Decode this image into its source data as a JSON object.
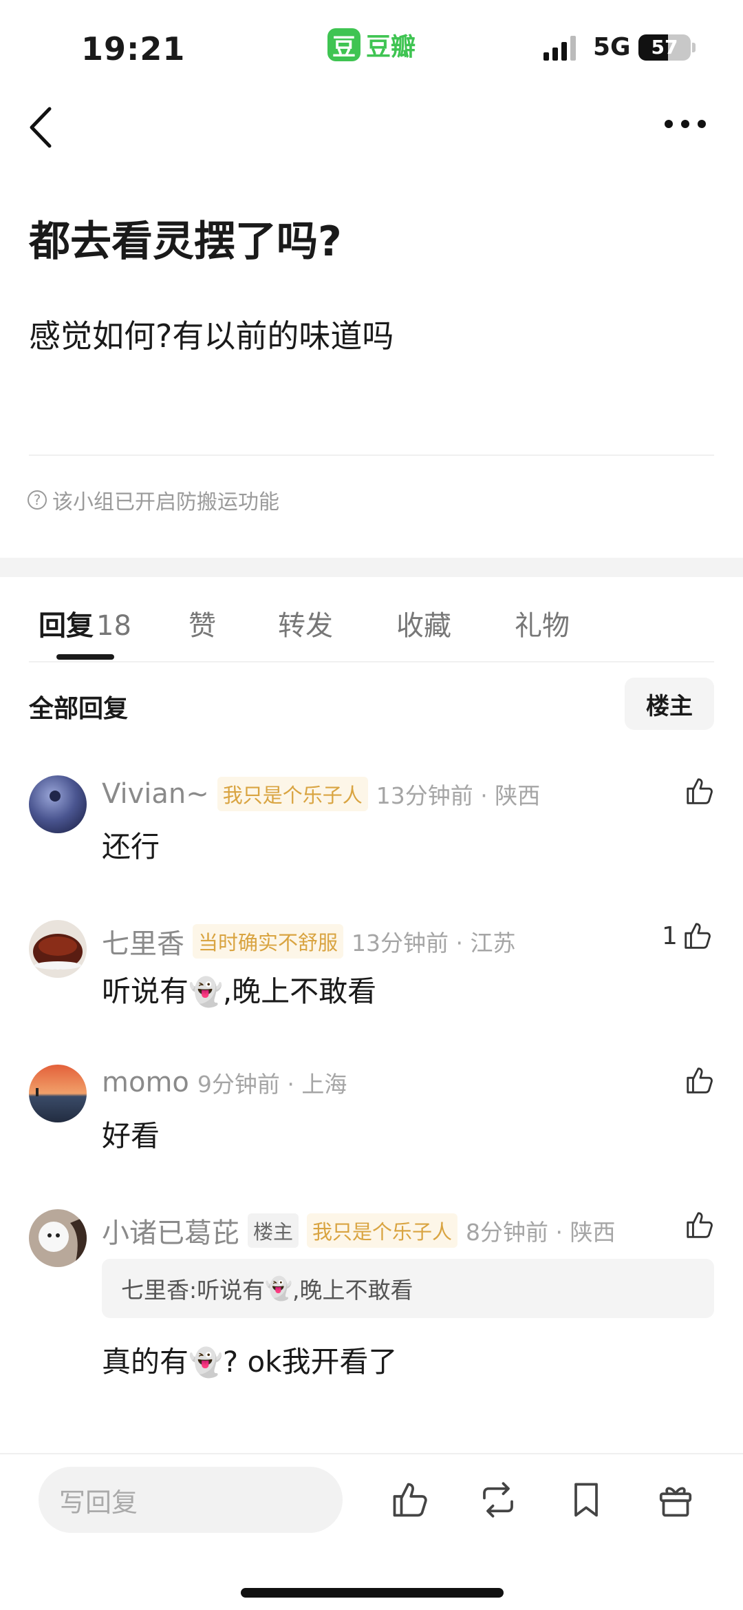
{
  "status_bar": {
    "time": "19:21",
    "app_logo": "豆",
    "app_name": "豆瓣",
    "network": "5G",
    "battery": "57",
    "battery_level_percent": 57
  },
  "nav": {
    "back_icon": "chevron-left-icon",
    "more_icon": "more-horizontal-icon"
  },
  "post": {
    "title": "都去看灵摆了吗?",
    "body": "感觉如何?有以前的味道吗",
    "notice": "该小组已开启防搬运功能"
  },
  "tabs": [
    {
      "label": "回复",
      "count": "18",
      "active": true
    },
    {
      "label": "赞"
    },
    {
      "label": "转发"
    },
    {
      "label": "收藏"
    },
    {
      "label": "礼物"
    }
  ],
  "replies_header": {
    "title": "全部回复",
    "op_filter": "楼主"
  },
  "comments": [
    {
      "user": "Vivian~",
      "badge": "我只是个乐子人",
      "time": "13分钟前 · 陕西",
      "text": "还行",
      "likes": ""
    },
    {
      "user": "七里香",
      "badge": "当时确实不舒服",
      "time": "13分钟前 · 江苏",
      "text_before": "听说有",
      "emoji": "👻",
      "text_after": ",晚上不敢看",
      "likes": "1"
    },
    {
      "user": "momo",
      "time": "9分钟前 · 上海",
      "text": "好看",
      "likes": ""
    },
    {
      "user": "小诸已葛芘",
      "op_badge": "楼主",
      "badge": "我只是个乐子人",
      "time": "8分钟前 · 陕西",
      "quote_before": "七里香:听说有",
      "quote_emoji": "👻",
      "quote_after": ",晚上不敢看",
      "text_before": "真的有",
      "emoji": "👻",
      "text_after": "? ok我开看了",
      "likes": ""
    }
  ],
  "bottom_bar": {
    "reply_placeholder": "写回复",
    "icons": [
      "thumbs-up-icon",
      "repost-icon",
      "bookmark-icon",
      "gift-icon"
    ]
  },
  "colors": {
    "brand": "#3fc452",
    "badge_text": "#d9a441",
    "badge_bg": "#fdf6e8"
  }
}
